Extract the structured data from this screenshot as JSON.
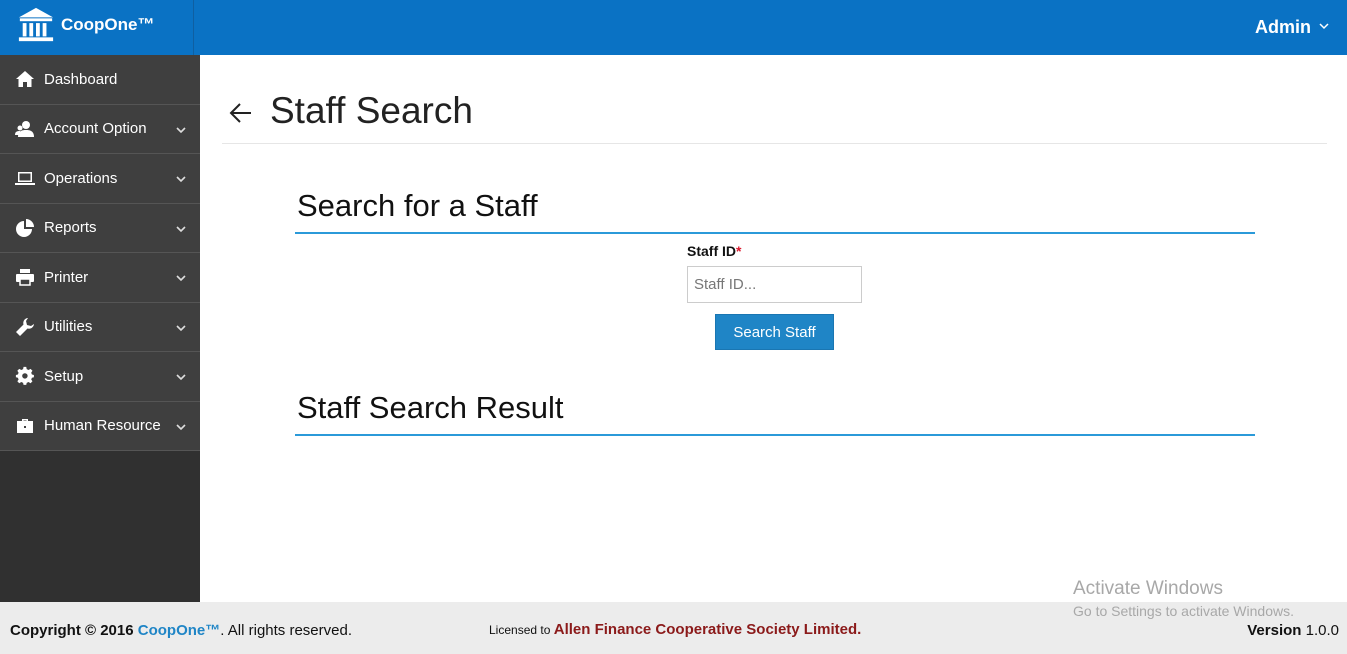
{
  "brand": {
    "name": "CoopOne™",
    "icon": "bank-icon"
  },
  "user_menu": {
    "label": "Admin",
    "icon": "chevron-down-icon"
  },
  "sidebar": {
    "items": [
      {
        "label": "Dashboard",
        "icon": "home-icon",
        "expandable": false
      },
      {
        "label": "Account Option",
        "icon": "users-icon",
        "expandable": true
      },
      {
        "label": "Operations",
        "icon": "laptop-icon",
        "expandable": true
      },
      {
        "label": "Reports",
        "icon": "pie-chart-icon",
        "expandable": true
      },
      {
        "label": "Printer",
        "icon": "printer-icon",
        "expandable": true
      },
      {
        "label": "Utilities",
        "icon": "wrench-icon",
        "expandable": true
      },
      {
        "label": "Setup",
        "icon": "gear-icon",
        "expandable": true
      },
      {
        "label": "Human Resource",
        "icon": "briefcase-icon",
        "expandable": true
      }
    ]
  },
  "page": {
    "title": "Staff Search",
    "search_section_title": "Search for a Staff",
    "result_section_title": "Staff Search Result",
    "staff_id": {
      "label": "Staff ID",
      "required_mark": "*",
      "placeholder": "Staff ID...",
      "value": ""
    },
    "search_button": "Search Staff"
  },
  "footer": {
    "copyright_prefix": "Copyright © 2016",
    "copyright_brand": "CoopOne™",
    "copyright_suffix": ". All rights reserved.",
    "licensed_prefix": "Licensed to",
    "licensed_name": "Allen Finance Cooperative Society Limited",
    "licensed_suffix": ".",
    "version_label": "Version",
    "version_value": "1.0.0"
  },
  "watermark": {
    "line1": "Activate Windows",
    "line2": "Go to Settings to activate Windows."
  },
  "colors": {
    "topbar": "#0a72c4",
    "sidebar": "#3f3f3f",
    "accent": "#1f85c6",
    "section_rule": "#2b9ad9",
    "licensee": "#8b1a1a"
  }
}
